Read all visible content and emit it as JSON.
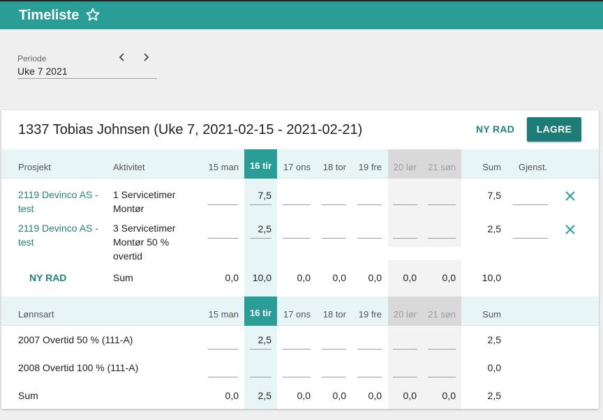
{
  "app": {
    "title": "Timeliste",
    "favorite_icon": "star-outline-icon"
  },
  "period": {
    "label": "Periode",
    "value": "Uke 7 2021"
  },
  "card": {
    "title": "1337 Tobias Johnsen (Uke 7, 2021-02-15 - 2021-02-21)",
    "new_row_label": "NY RAD",
    "save_label": "LAGRE"
  },
  "projects_table": {
    "headers": {
      "project": "Prosjekt",
      "activity": "Aktivitet",
      "days": [
        "15 man",
        "16 tir",
        "17 ons",
        "18 tor",
        "19 fre",
        "20 lør",
        "21 søn"
      ],
      "sum": "Sum",
      "remaining": "Gjenst."
    },
    "rows": [
      {
        "project_line1": "2119 Devinco AS -",
        "project_line2": "test",
        "activity_line1": "1 Servicetimer",
        "activity_line2": "Montør",
        "activity_line3": "",
        "hours": [
          "",
          "7,5",
          "",
          "",
          "",
          "",
          ""
        ],
        "sum": "7,5"
      },
      {
        "project_line1": "2119 Devinco AS -",
        "project_line2": "test",
        "activity_line1": "3 Servicetimer",
        "activity_line2": "Montør 50 %",
        "activity_line3": "overtid",
        "hours": [
          "",
          "2,5",
          "",
          "",
          "",
          "",
          ""
        ],
        "sum": "2,5"
      }
    ],
    "footer": {
      "new_row_label": "NY RAD",
      "sum_label": "Sum",
      "totals": [
        "0,0",
        "10,0",
        "0,0",
        "0,0",
        "0,0",
        "0,0",
        "0,0"
      ],
      "sum": "10,0"
    }
  },
  "wages_table": {
    "headers": {
      "wage_type": "Lønnsart",
      "days": [
        "15 man",
        "16 tir",
        "17 ons",
        "18 tor",
        "19 fre",
        "20 lør",
        "21 søn"
      ],
      "sum": "Sum"
    },
    "rows": [
      {
        "label": "2007 Overtid 50 % (111-A)",
        "hours": [
          "",
          "2,5",
          "",
          "",
          "",
          "",
          ""
        ],
        "sum": "2,5"
      },
      {
        "label": "2008 Overtid 100 % (111-A)",
        "hours": [
          "",
          "",
          "",
          "",
          "",
          "",
          ""
        ],
        "sum": "0,0"
      }
    ],
    "footer": {
      "sum_label": "Sum",
      "totals": [
        "0,0",
        "2,5",
        "0,0",
        "0,0",
        "0,0",
        "0,0",
        "0,0"
      ],
      "sum": "2,5"
    }
  },
  "colors": {
    "primary": "#2a9d97",
    "accent_text": "#22817d",
    "save_button": "#1e7c78",
    "header_band": "#e8f5f7"
  },
  "icons": {
    "prev": "chevron-left-icon",
    "next": "chevron-right-icon",
    "delete": "close-icon"
  }
}
